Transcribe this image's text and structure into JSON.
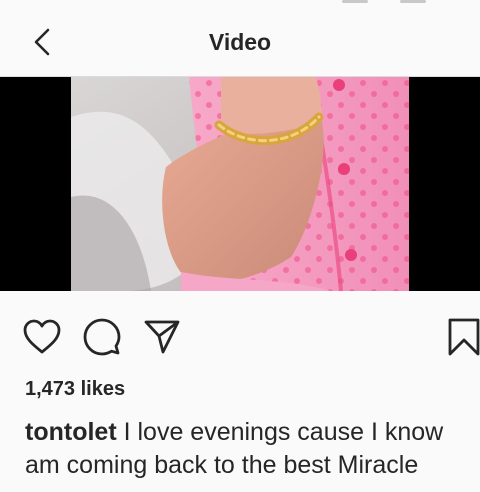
{
  "header": {
    "title": "Video"
  },
  "post": {
    "likes": "1,473 likes",
    "username": "tontolet",
    "caption_lines": [
      "I love evenings cause I know",
      "am coming back to the best Miracle"
    ]
  },
  "icons": {
    "back": "chevron-left-icon",
    "like": "heart-icon",
    "comment": "comment-bubble-icon",
    "share": "paper-plane-icon",
    "save": "bookmark-icon"
  },
  "colors": {
    "background": "#fafafa",
    "text": "#262626",
    "divider": "#dbdbdb",
    "video_letterbox": "#000000",
    "pajama_pink": "#f49ac1"
  }
}
